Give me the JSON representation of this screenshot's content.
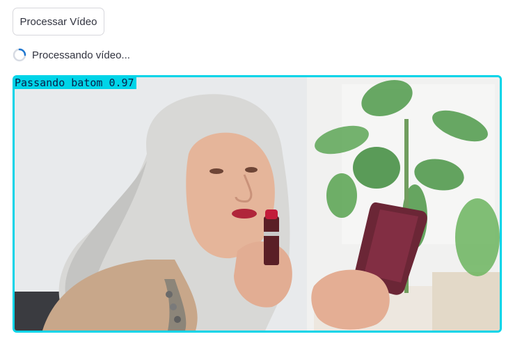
{
  "toolbar": {
    "process_button_label": "Processar Vídeo"
  },
  "status": {
    "text": "Processando vídeo..."
  },
  "video": {
    "detection_label": "Passando batom 0.97",
    "border_color": "#00d4e8"
  },
  "colors": {
    "spinner_accent": "#1f77d0",
    "spinner_track": "#d7dbe3"
  }
}
